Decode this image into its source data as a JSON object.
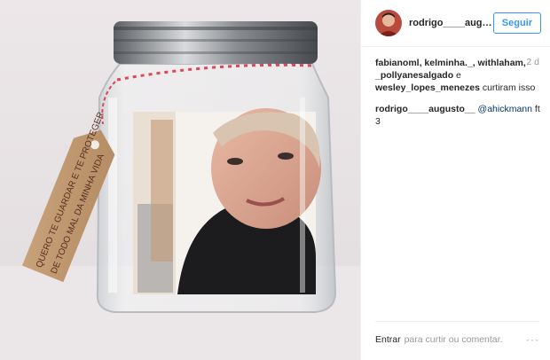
{
  "post": {
    "username": "rodrigo____augusto...",
    "follow_label": "Seguir",
    "time_ago": "2 d",
    "likers": "fabianoml, kelminha._, withlaham, _pollyanesalgado",
    "likers_joiner": "e",
    "likers_last": "wesley_lopes_menezes",
    "likes_suffix": "curtiram isso",
    "caption_user": "rodrigo____augusto__",
    "caption_mention": "@ahickmann",
    "caption_text": "ft 3",
    "footer_login": "Entrar",
    "footer_text": "para curtir ou comentar.",
    "more_icon": "···"
  },
  "photo": {
    "tag_text_line1": "QUERO TE GUARDAR E TE PROTEGER",
    "tag_text_line2": "DE TODO MAL DA MINHA VIDA"
  },
  "colors": {
    "accent": "#3897f0",
    "bg": "#ffffff",
    "muted": "#999999"
  }
}
